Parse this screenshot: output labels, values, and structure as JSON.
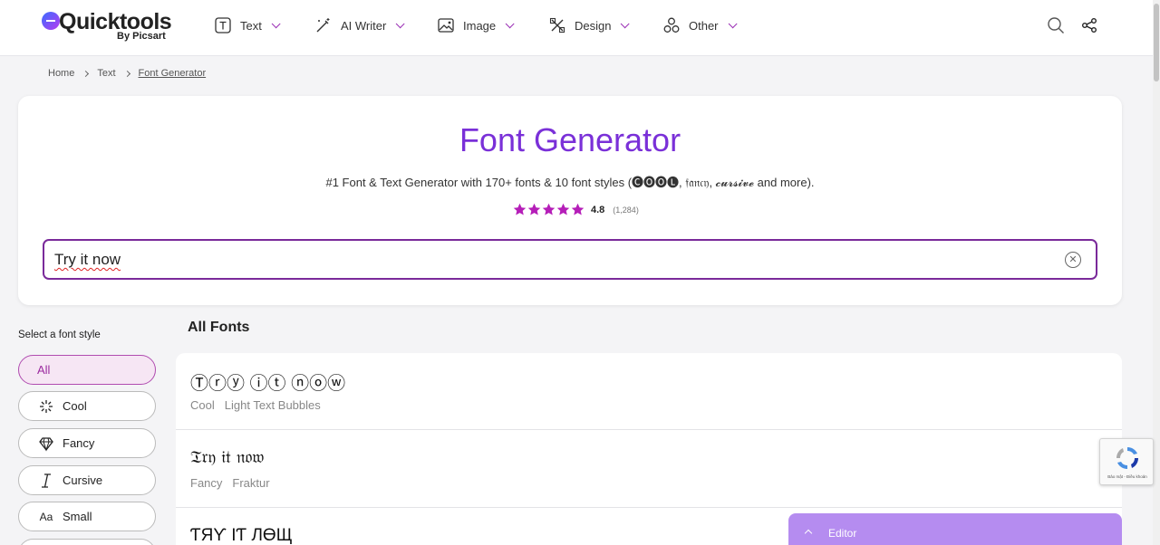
{
  "header": {
    "logo_text": "Quicktools",
    "logo_sub": "By Picsart",
    "nav": [
      {
        "label": "Text",
        "icon": "text-box-icon"
      },
      {
        "label": "AI Writer",
        "icon": "magic-wand-icon"
      },
      {
        "label": "Image",
        "icon": "image-icon"
      },
      {
        "label": "Design",
        "icon": "design-tools-icon"
      },
      {
        "label": "Other",
        "icon": "shapes-icon"
      }
    ],
    "search_icon": "search-icon",
    "share_icon": "share-icon"
  },
  "breadcrumb": [
    "Home",
    "Text",
    "Font Generator"
  ],
  "hero": {
    "title": "Font Generator",
    "subtitle": "#1 Font & Text Generator with 170+ fonts & 10 font styles (🅒🅞🅞🅛, 𝔣𝔞𝔫𝔠𝔶, 𝓬𝓾𝓻𝓼𝓲𝓿𝓮 and more).",
    "rating": "4.8",
    "rating_count": "(1,284)",
    "stars": 5,
    "input_value": "Try it now"
  },
  "sidebar": {
    "label": "Select a font style",
    "styles": [
      {
        "label": "All",
        "icon": "",
        "active": true
      },
      {
        "label": "Cool",
        "icon": "sparkle-icon"
      },
      {
        "label": "Fancy",
        "icon": "diamond-icon"
      },
      {
        "label": "Cursive",
        "icon": "cursive-i-icon"
      },
      {
        "label": "Small",
        "icon": "small-aa-icon"
      }
    ]
  },
  "main": {
    "heading": "All Fonts",
    "fonts": [
      {
        "sample": "Ⓣⓡⓨ ⓘⓣ ⓝⓞⓦ",
        "category": "Cool",
        "name": "Light Text Bubbles"
      },
      {
        "sample": "𝔗𝔯𝔶 𝔦𝔱 𝔫𝔬𝔴",
        "category": "Fancy",
        "name": "Fraktur"
      },
      {
        "sample": "ƬЯƳ IƬ ЛӨЩ",
        "category": "",
        "name": ""
      }
    ]
  },
  "editor": {
    "label": "Editor"
  },
  "recaptcha": {
    "text": "Bảo mật - Điều khoản"
  },
  "colors": {
    "brand_purple": "#7a30d8",
    "accent_magenta": "#9b2fb5",
    "editor_bg": "#b58cf0"
  }
}
